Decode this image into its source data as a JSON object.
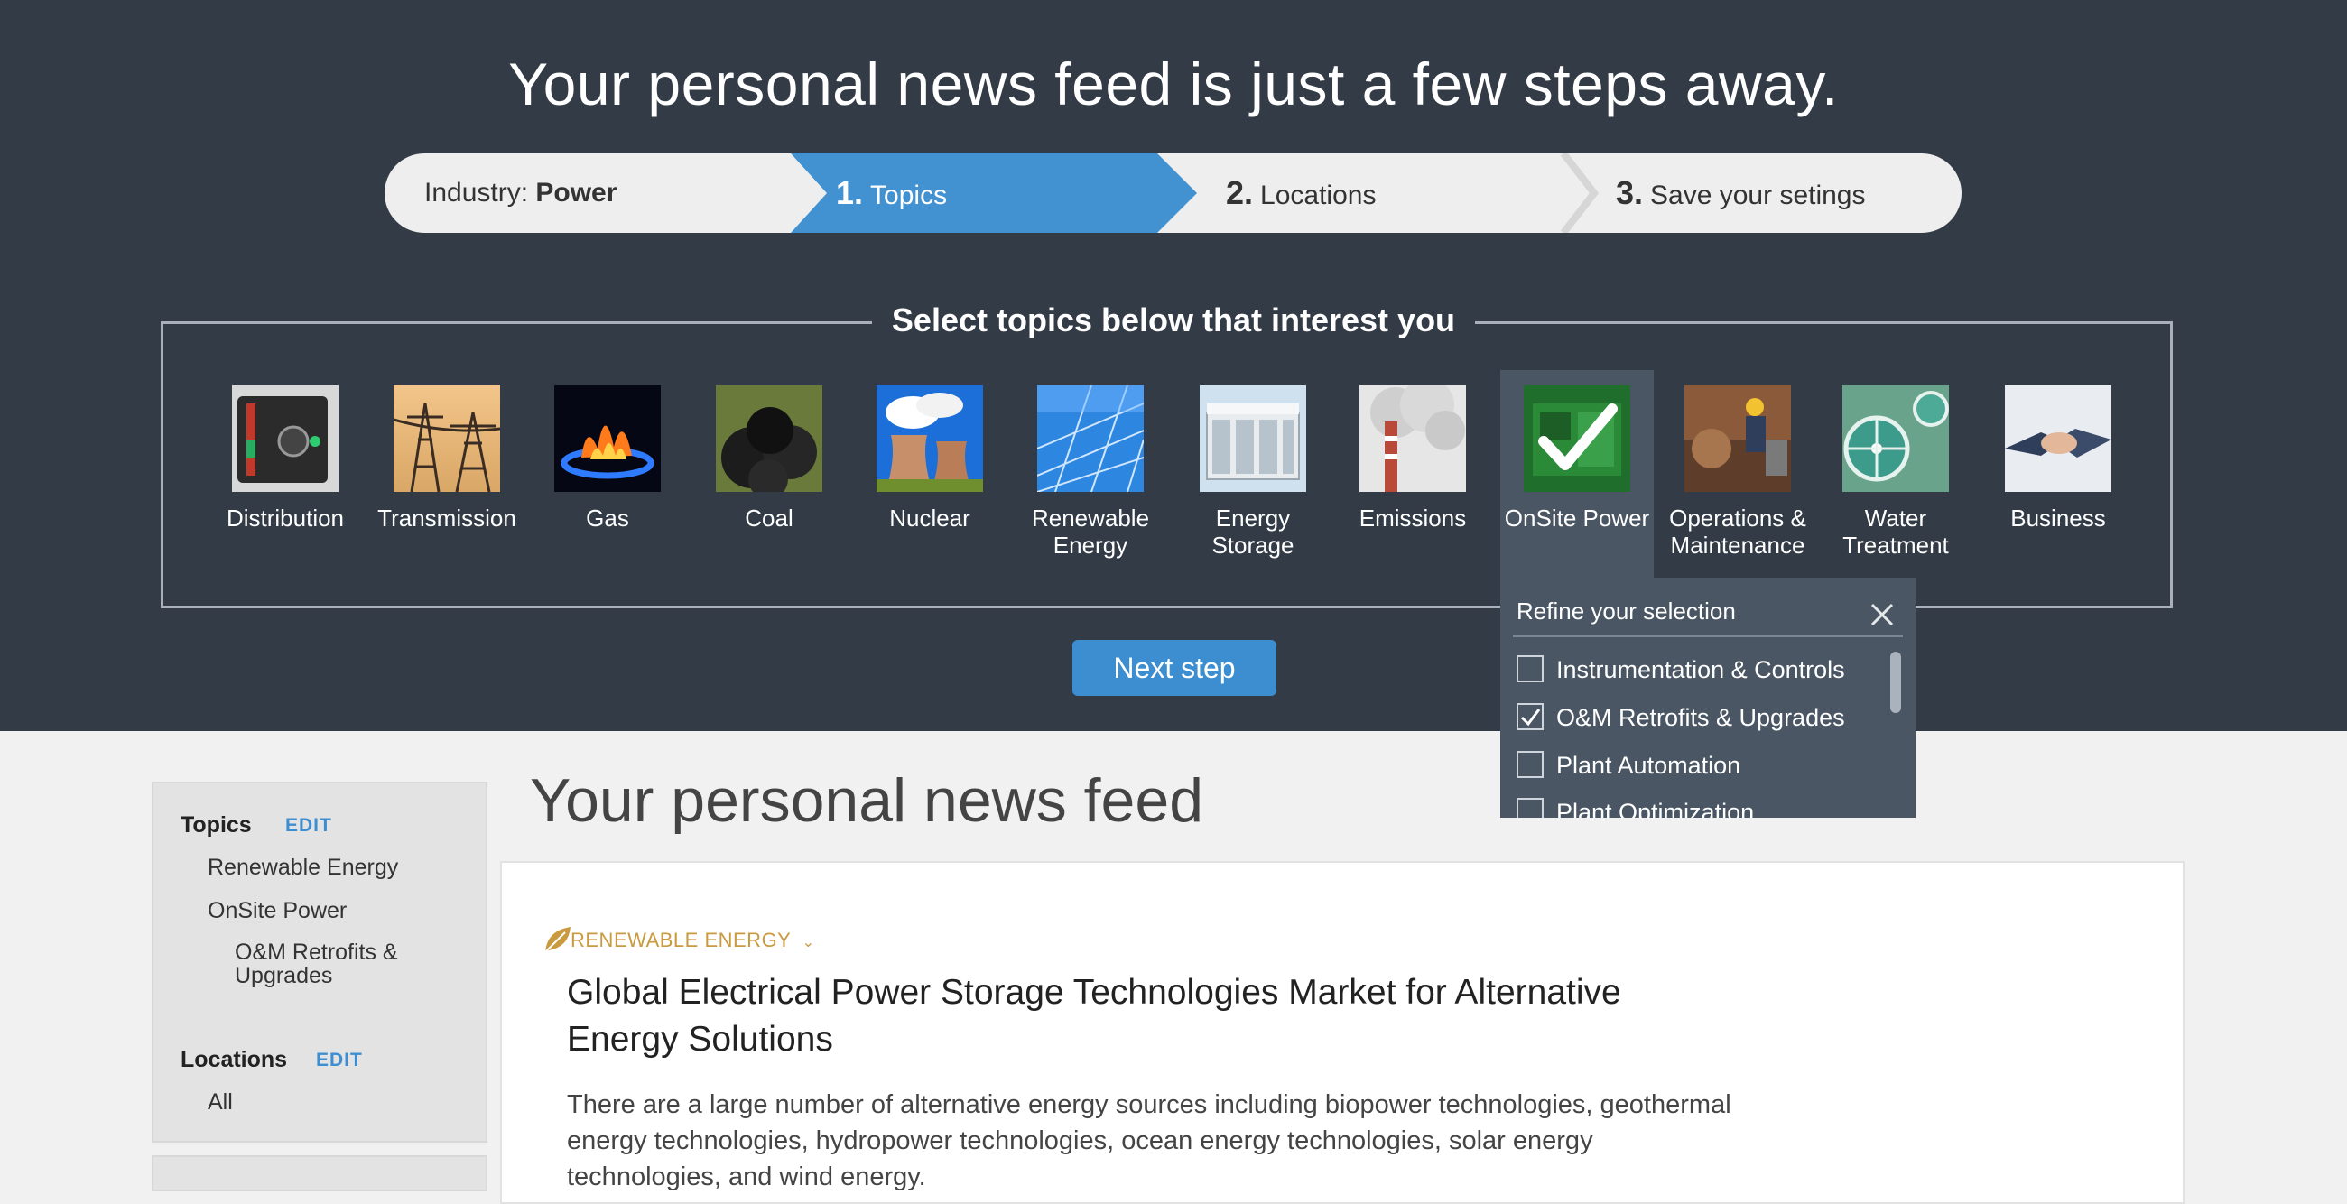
{
  "headline": "Your personal news feed is just a few steps away.",
  "stepper": {
    "industry_prefix": "Industry: ",
    "industry_value": "Power",
    "steps": [
      {
        "num": "1.",
        "label": "Topics"
      },
      {
        "num": "2.",
        "label": "Locations"
      },
      {
        "num": "3.",
        "label": "Save your setings"
      }
    ]
  },
  "topics_section": {
    "title": "Select topics below that interest you",
    "tiles": [
      {
        "label": "Distribution",
        "icon": "distribution-image"
      },
      {
        "label": "Transmission",
        "icon": "transmission-image"
      },
      {
        "label": "Gas",
        "icon": "gas-image"
      },
      {
        "label": "Coal",
        "icon": "coal-image"
      },
      {
        "label": "Nuclear",
        "icon": "nuclear-image"
      },
      {
        "label": "Renewable Energy",
        "icon": "renewable-energy-image"
      },
      {
        "label": "Energy Storage",
        "icon": "energy-storage-image"
      },
      {
        "label": "Emissions",
        "icon": "emissions-image"
      },
      {
        "label": "OnSite Power",
        "icon": "onsite-power-image",
        "selected": true
      },
      {
        "label": "Operations & Maintenance",
        "icon": "operations-maintenance-image"
      },
      {
        "label": "Water Treatment",
        "icon": "water-treatment-image"
      },
      {
        "label": "Business",
        "icon": "business-image"
      }
    ]
  },
  "refine": {
    "title": "Refine your selection",
    "options": [
      {
        "label": "Instrumentation & Controls",
        "checked": false
      },
      {
        "label": "O&M Retrofits & Upgrades",
        "checked": true
      },
      {
        "label": "Plant Automation",
        "checked": false
      },
      {
        "label": "Plant Optimization",
        "checked": false
      }
    ]
  },
  "next_button": "Next step",
  "sidebar": {
    "topics_heading": "Topics",
    "topics_edit": "EDIT",
    "topics": [
      "Renewable Energy",
      "OnSite Power"
    ],
    "subtopic": "O&M Retrofits & Upgrades",
    "locations_heading": "Locations",
    "locations_edit": "EDIT",
    "locations": [
      "All"
    ]
  },
  "feed": {
    "title": "Your personal news feed",
    "article": {
      "category": "RENEWABLE ENERGY",
      "title": "Global Electrical Power Storage Technologies Market for Alternative Energy Solutions",
      "excerpt": "There are a large number of alternative energy sources including biopower technologies, geothermal energy technologies, hydropower technologies, ocean energy technologies, solar energy technologies, and wind energy."
    }
  },
  "colors": {
    "dark_bg": "#323b46",
    "accent": "#3d8ed0",
    "category": "#c99a3f"
  }
}
